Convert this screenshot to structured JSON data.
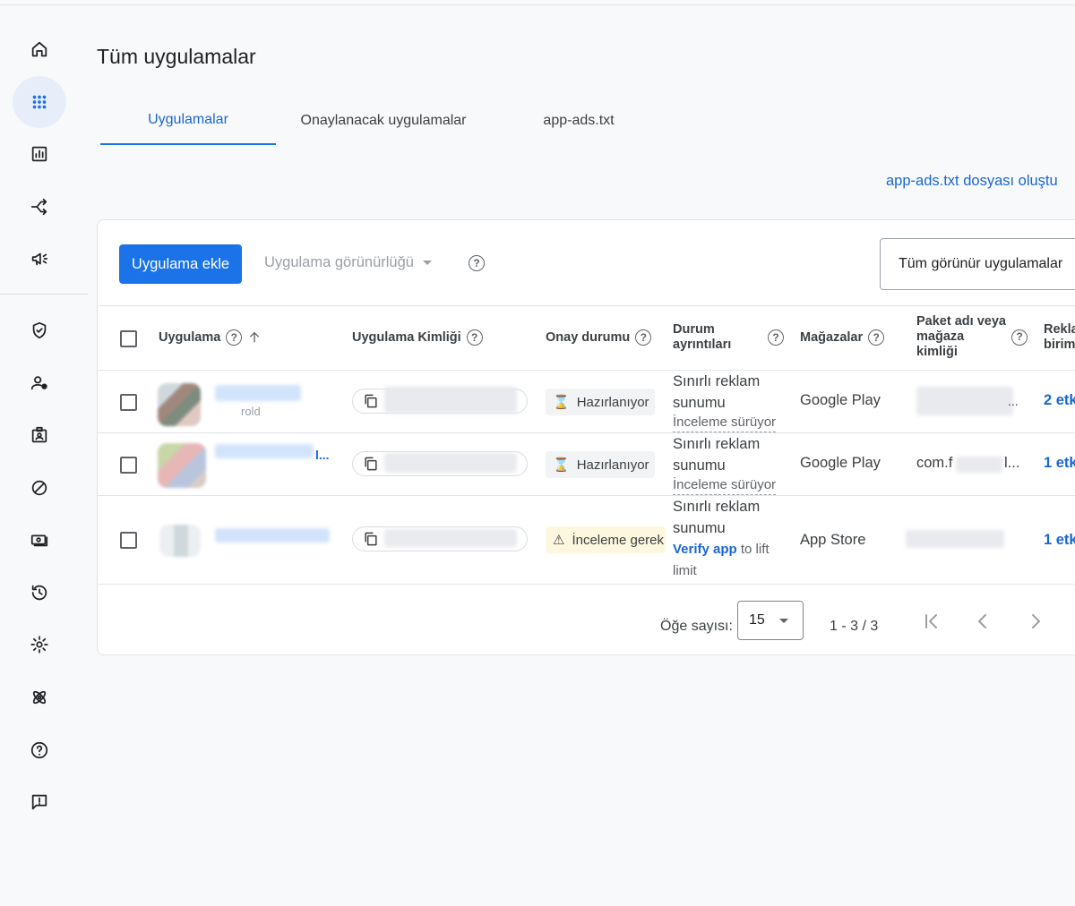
{
  "page": {
    "title": "Tüm uygulamalar",
    "tabs": [
      {
        "label": "Uygulamalar",
        "active": true
      },
      {
        "label": "Onaylanacak uygulamalar",
        "active": false
      },
      {
        "label": "app-ads.txt",
        "active": false
      }
    ],
    "create_link": "app-ads.txt dosyası oluştu"
  },
  "nav": {
    "items": [
      "home-icon",
      "apps-grid-icon",
      "reports-icon",
      "mediation-icon",
      "campaigns-icon",
      "privacy-shield-icon",
      "user-icon",
      "id-card-icon",
      "blocking-icon",
      "payments-icon",
      "history-icon",
      "settings-icon",
      "atom-icon",
      "help-icon",
      "feedback-icon"
    ],
    "active": "apps-grid-icon"
  },
  "toolbar": {
    "add_button": "Uygulama ekle",
    "visibility_dropdown": "Uygulama görünürlüğü",
    "filter_dropdown": "Tüm görünür uygulamalar"
  },
  "table": {
    "columns": [
      "Uygulama",
      "Uygulama Kimliği",
      "Onay durumu",
      "Durum ayrıntıları",
      "Mağazalar",
      "Paket adı veya mağaza kimliği",
      "Reklam birimleri"
    ],
    "rows": [
      {
        "app_name_partial": "rold",
        "approval": "Hazırlanıyor",
        "detail_main": "Sınırlı reklam sunumu",
        "detail_sub": "İnceleme sürüyor",
        "store": "Google Play",
        "package_partial": "...",
        "ad_units": "2 etk"
      },
      {
        "app_name_partial": "l...",
        "approval": "Hazırlanıyor",
        "detail_main": "Sınırlı reklam sunumu",
        "detail_sub": "İnceleme sürüyor",
        "store": "Google Play",
        "package_partial": "com.f",
        "package_tail": "l...",
        "ad_units": "1 etk"
      },
      {
        "app_name_partial": "",
        "approval": "İnceleme gerek",
        "detail_main": "Sınırlı reklam sunumu",
        "detail_link": "Verify app",
        "detail_after": "to lift limit",
        "store": "App Store",
        "package_partial": "",
        "ad_units": "1 etk"
      }
    ]
  },
  "pagination": {
    "label": "Öğe sayısı:",
    "page_size": "15",
    "range": "1 - 3 / 3"
  },
  "colors": {
    "accent": "#1a73e8",
    "link": "#1967d2",
    "warning_bg": "#fef7e0"
  }
}
